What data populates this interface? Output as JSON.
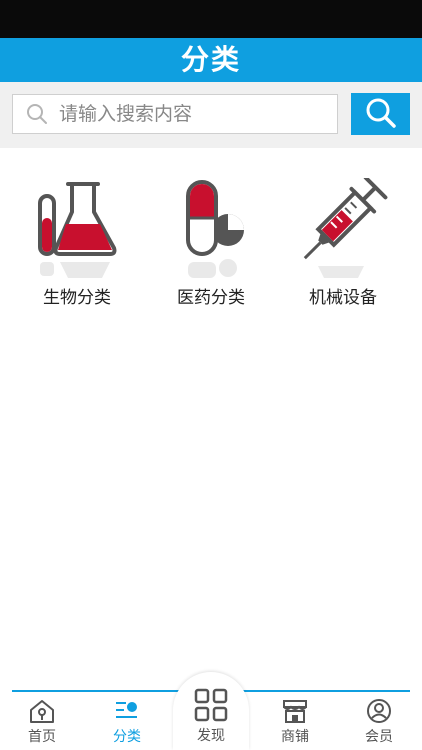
{
  "header": {
    "title": "分类"
  },
  "search": {
    "placeholder": "请输入搜索内容",
    "value": "",
    "input_icon": "search-icon",
    "button_icon": "search-icon"
  },
  "categories": [
    {
      "label": "生物分类",
      "icon": "lab-flask-icon"
    },
    {
      "label": "医药分类",
      "icon": "pill-capsule-icon"
    },
    {
      "label": "机械设备",
      "icon": "syringe-icon"
    }
  ],
  "tabs": [
    {
      "label": "首页",
      "icon": "home-icon",
      "active": false
    },
    {
      "label": "分类",
      "icon": "category-list-icon",
      "active": true
    },
    {
      "label": "发现",
      "icon": "grid-icon",
      "active": false
    },
    {
      "label": "商铺",
      "icon": "shop-icon",
      "active": false
    },
    {
      "label": "会员",
      "icon": "user-icon",
      "active": false
    }
  ],
  "colors": {
    "accent": "#0f9fe0",
    "status_bar": "#0a0a0a",
    "icon_red": "#c8102e",
    "icon_gray": "#555555"
  }
}
